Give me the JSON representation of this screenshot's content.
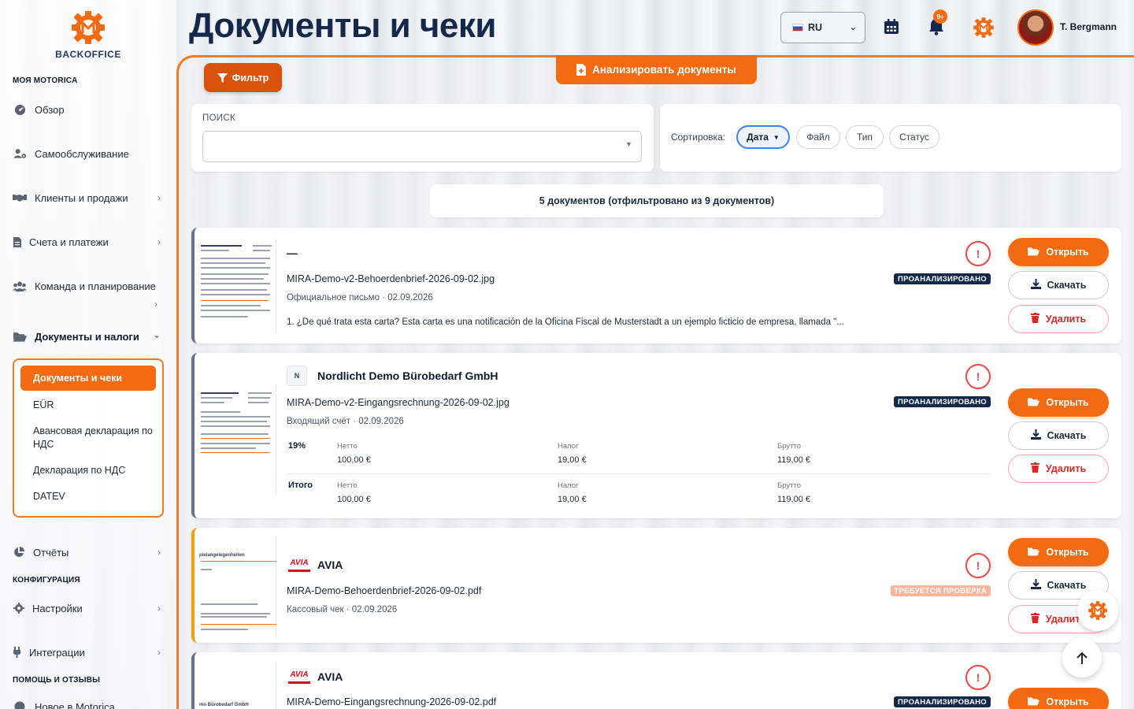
{
  "app": {
    "logo_text": "BACKOFFICE",
    "brand_color": "#f26a12",
    "navy_color": "#13284a"
  },
  "header": {
    "title": "Документы и чеки",
    "language": "RU",
    "notifications_badge": "9+",
    "user_name": "T. Bergmann"
  },
  "sidebar": {
    "section_my": "МОЯ MOTORICA",
    "section_config": "КОНФИГУРАЦИЯ",
    "section_help": "ПОМОЩЬ И ОТЗЫВЫ",
    "items": {
      "overview": "Обзор",
      "selfservice": "Самообслуживание",
      "clients": "Клиенты и продажи",
      "invoices": "Счета и платежи",
      "team": "Команда и планирование",
      "docs": "Документы и налоги",
      "reports": "Отчёты",
      "settings": "Настройки",
      "integrations": "Интеграции",
      "about": "Новое в Motorica"
    },
    "submenu": {
      "active": "Документы и чеки",
      "eur": "EÜR",
      "vat_advance": "Авансовая декларация по НДС",
      "vat_return": "Декларация по НДС",
      "datev": "DATEV"
    }
  },
  "toolbar": {
    "filter_label": "Фильтр",
    "analyze_label": "Анализировать документы",
    "search_label": "ПОИСК",
    "search_value": "",
    "sort_label": "Сортировка:",
    "sort_options": [
      "Дата",
      "Файл",
      "Тип",
      "Статус"
    ],
    "sort_active": "Дата",
    "count_text": "5 документов (отфильтровано из 9 документов)"
  },
  "actions": {
    "open": "Открыть",
    "download": "Скачать",
    "delete": "Удалить"
  },
  "documents": [
    {
      "title": "—",
      "file": "MIRA-Demo-v2-Behoerdenbrief-2026-09-02.jpg",
      "meta": "Официальное письмо · 02.09.2026",
      "status": "ПРОАНАЛИЗИРОВАНО",
      "description": "1. ¿De qué trata esta carta? Esta carta es una notificación de la Oficina Fiscal de Musterstadt a un ejemplo ficticio de empresa, llamada \"..."
    },
    {
      "logo": "N",
      "title": "Nordlicht Demo Bürobedarf GmbH",
      "file": "MIRA-Demo-v2-Eingangsrechnung-2026-09-02.jpg",
      "meta": "Входящий счёт · 02.09.2026",
      "status": "ПРОАНАЛИЗИРОВАНО",
      "tax_rows": [
        {
          "rate": "19%",
          "net_label": "Нетто",
          "net": "100,00 €",
          "tax_label": "Налог",
          "tax": "19,00 €",
          "gross_label": "Брутто",
          "gross": "119,00 €"
        },
        {
          "rate": "Итого",
          "net_label": "Нетто",
          "net": "100,00 €",
          "tax_label": "Налог",
          "tax": "19,00 €",
          "gross_label": "Брутто",
          "gross": "119,00 €"
        }
      ]
    },
    {
      "logo": "AVIA",
      "title": "AVIA",
      "file": "MIRA-Demo-Behoerdenbrief-2026-09-02.pdf",
      "meta": "Кассовый чек · 02.09.2026",
      "status": "ТРЕБУЕТСЯ ПРОВЕРКА",
      "thumb_text": "pielangelegenheiten"
    },
    {
      "logo": "AVIA",
      "title": "AVIA",
      "file": "MIRA-Demo-Eingangsrechnung-2026-09-02.pdf",
      "status": "ПРОАНАЛИЗИРОВАНО",
      "thumb_text": "mo Bürobedarf GmbH"
    }
  ]
}
